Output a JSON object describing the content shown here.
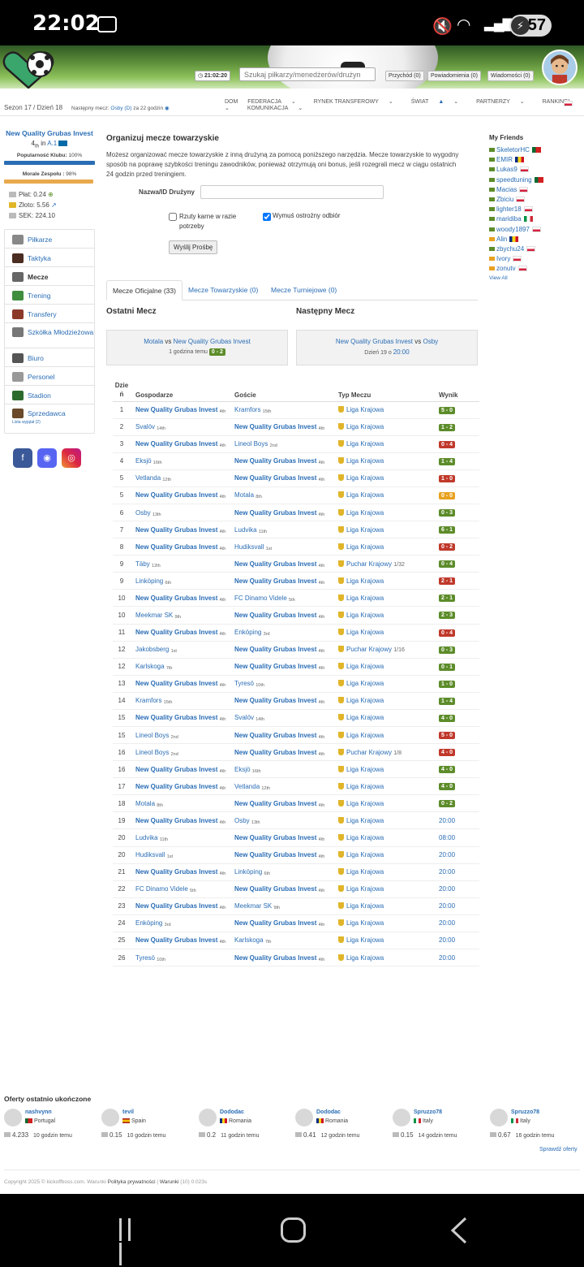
{
  "status": {
    "time": "22:02",
    "battery": "57"
  },
  "header": {
    "clock": "21:02:20",
    "search_placeholder": "Szukaj piłkarzy/menedżerów/drużyn",
    "income": "Przychód (0)",
    "notifications": "Powiadomienia (0)",
    "messages": "Wiadomości (0)"
  },
  "subheader": {
    "season": "Sezon 17 / Dzień 18",
    "next_prefix": "Następny mecz: ",
    "next_team": "Osby (D)",
    "next_suffix": " za 22 godzin",
    "nav": [
      "DOM",
      "FEDERACJA",
      "RYNEK TRANSFEROWY",
      "ŚWIAT",
      "PARTNERZY",
      "RANKINGI",
      "KOMUNIKACJA"
    ]
  },
  "club": {
    "name": "New Quality Grubas Invest",
    "rank_pos": "4",
    "rank_suffix": "th",
    "rank_in": " in ",
    "league": "A.1",
    "popularity_label": "Popularność Klubu:",
    "popularity": "100%",
    "popularity_value": 100,
    "morale_label": "Morale Zespołu :",
    "morale": "98%",
    "morale_value": 98,
    "salary": "Płat: 0.24",
    "gold": "Złoto: 5.56",
    "sek": "SEK: 224.10"
  },
  "sidenav": [
    "Piłkarze",
    "Taktyka",
    "Mecze",
    "Trening",
    "Transfery",
    "Szkółka Młodzieżowa",
    "Biuro",
    "Personel",
    "Stadion",
    "Sprzedawca"
  ],
  "sidenav_sub": "Lista wyjątał (2)",
  "organize": {
    "title": "Organizuj mecze towarzyskie",
    "desc": "Możesz organizować mecze towarzyskie z inną drużyną za pomocą poniższego narzędzia. Mecze towarzyskie to wygodny sposób na poprawę szybkości treningu zawodników, ponieważ otrzymują oni bonus, jeśli rozegrali mecz w ciągu ostatnich 24 godzin przed treningiem.",
    "team_label": "Nazwa/ID Drużyny",
    "penalties_label": "Rzuty karne w razie potrzeby",
    "careful_label": "Wymuś ostrożny odbiór",
    "send_label": "Wyślij Prośbę"
  },
  "tabs": [
    "Mecze Oficjalne (33)",
    "Mecze Towarzyskie (0)",
    "Mecze Turniejowe (0)"
  ],
  "last_match": {
    "title": "Ostatni Mecz",
    "home": "Motala",
    "vs": " vs ",
    "away": "New Quality Grubas Invest",
    "when": "1 godzina temu",
    "score": "0 - 2"
  },
  "next_match": {
    "title": "Następny Mecz",
    "home": "New Quality Grubas Invest",
    "vs": " vs ",
    "away": "Osby",
    "when": "Dzień 19 o ",
    "time": "20:00"
  },
  "table": {
    "headers": [
      "Dzień",
      "Gospodarze",
      "Goście",
      "Typ Meczu",
      "Wynik"
    ],
    "rows": [
      {
        "day": "1",
        "home": "New Quality Grubas Invest",
        "hr": "4th",
        "away": "Kramfors",
        "ar": "15th",
        "type": "Liga Krajowa",
        "result": "5 - 0",
        "res": "w"
      },
      {
        "day": "2",
        "home": "Svalöv",
        "hr": "14th",
        "away": "New Quality Grubas Invest",
        "ar": "4th",
        "type": "Liga Krajowa",
        "result": "1 - 2",
        "res": "w"
      },
      {
        "day": "3",
        "home": "New Quality Grubas Invest",
        "hr": "4th",
        "away": "Lineol Boys",
        "ar": "2nd",
        "type": "Liga Krajowa",
        "result": "0 - 4",
        "res": "l"
      },
      {
        "day": "4",
        "home": "Eksjö",
        "hr": "16th",
        "away": "New Quality Grubas Invest",
        "ar": "4th",
        "type": "Liga Krajowa",
        "result": "1 - 4",
        "res": "w"
      },
      {
        "day": "5",
        "home": "Vetlanda",
        "hr": "12th",
        "away": "New Quality Grubas Invest",
        "ar": "4th",
        "type": "Liga Krajowa",
        "result": "1 - 0",
        "res": "l"
      },
      {
        "day": "5",
        "home": "New Quality Grubas Invest",
        "hr": "4th",
        "away": "Motala",
        "ar": "8th",
        "type": "Liga Krajowa",
        "result": "0 - 0",
        "res": "d"
      },
      {
        "day": "6",
        "home": "Osby",
        "hr": "13th",
        "away": "New Quality Grubas Invest",
        "ar": "4th",
        "type": "Liga Krajowa",
        "result": "0 - 3",
        "res": "w"
      },
      {
        "day": "7",
        "home": "New Quality Grubas Invest",
        "hr": "4th",
        "away": "Ludvika",
        "ar": "11th",
        "type": "Liga Krajowa",
        "result": "6 - 1",
        "res": "w"
      },
      {
        "day": "8",
        "home": "New Quality Grubas Invest",
        "hr": "4th",
        "away": "Hudiksvall",
        "ar": "1st",
        "type": "Liga Krajowa",
        "result": "0 - 2",
        "res": "l"
      },
      {
        "day": "9",
        "home": "Täby",
        "hr": "12th",
        "away": "New Quality Grubas Invest",
        "ar": "4th",
        "type": "Puchar Krajowy",
        "round": "1/32",
        "result": "0 - 4",
        "res": "w"
      },
      {
        "day": "9",
        "home": "Linköping",
        "hr": "6th",
        "away": "New Quality Grubas Invest",
        "ar": "4th",
        "type": "Liga Krajowa",
        "result": "2 - 1",
        "res": "l"
      },
      {
        "day": "10",
        "home": "New Quality Grubas Invest",
        "hr": "4th",
        "away": "FC Dinamo Videle",
        "ar": "5th",
        "type": "Liga Krajowa",
        "result": "2 - 1",
        "res": "w"
      },
      {
        "day": "10",
        "home": "Meekmar SK",
        "hr": "9th",
        "away": "New Quality Grubas Invest",
        "ar": "4th",
        "type": "Liga Krajowa",
        "result": "2 - 3",
        "res": "w"
      },
      {
        "day": "11",
        "home": "New Quality Grubas Invest",
        "hr": "4th",
        "away": "Enköping",
        "ar": "3rd",
        "type": "Liga Krajowa",
        "result": "0 - 4",
        "res": "l"
      },
      {
        "day": "12",
        "home": "Jakobsberg",
        "hr": "1st",
        "away": "New Quality Grubas Invest",
        "ar": "4th",
        "type": "Puchar Krajowy",
        "round": "1/16",
        "result": "0 - 3",
        "res": "w"
      },
      {
        "day": "12",
        "home": "Karlskoga",
        "hr": "7th",
        "away": "New Quality Grubas Invest",
        "ar": "4th",
        "type": "Liga Krajowa",
        "result": "0 - 1",
        "res": "w"
      },
      {
        "day": "13",
        "home": "New Quality Grubas Invest",
        "hr": "4th",
        "away": "Tyresö",
        "ar": "10th",
        "type": "Liga Krajowa",
        "result": "1 - 0",
        "res": "w"
      },
      {
        "day": "14",
        "home": "Kramfors",
        "hr": "15th",
        "away": "New Quality Grubas Invest",
        "ar": "4th",
        "type": "Liga Krajowa",
        "result": "1 - 4",
        "res": "w"
      },
      {
        "day": "15",
        "home": "New Quality Grubas Invest",
        "hr": "4th",
        "away": "Svalöv",
        "ar": "14th",
        "type": "Liga Krajowa",
        "result": "4 - 0",
        "res": "w"
      },
      {
        "day": "15",
        "home": "Lineol Boys",
        "hr": "2nd",
        "away": "New Quality Grubas Invest",
        "ar": "4th",
        "type": "Liga Krajowa",
        "result": "5 - 0",
        "res": "l"
      },
      {
        "day": "16",
        "home": "Lineol Boys",
        "hr": "2nd",
        "away": "New Quality Grubas Invest",
        "ar": "4th",
        "type": "Puchar Krajowy",
        "round": "1/8",
        "result": "4 - 0",
        "res": "l"
      },
      {
        "day": "16",
        "home": "New Quality Grubas Invest",
        "hr": "4th",
        "away": "Eksjö",
        "ar": "16th",
        "type": "Liga Krajowa",
        "result": "4 - 0",
        "res": "w"
      },
      {
        "day": "17",
        "home": "New Quality Grubas Invest",
        "hr": "4th",
        "away": "Vetlanda",
        "ar": "12th",
        "type": "Liga Krajowa",
        "result": "4 - 0",
        "res": "w"
      },
      {
        "day": "18",
        "home": "Motala",
        "hr": "8th",
        "away": "New Quality Grubas Invest",
        "ar": "4th",
        "type": "Liga Krajowa",
        "result": "0 - 2",
        "res": "w"
      },
      {
        "day": "19",
        "home": "New Quality Grubas Invest",
        "hr": "4th",
        "away": "Osby",
        "ar": "13th",
        "type": "Liga Krajowa",
        "result": "20:00",
        "res": "t"
      },
      {
        "day": "20",
        "home": "Ludvika",
        "hr": "11th",
        "away": "New Quality Grubas Invest",
        "ar": "4th",
        "type": "Liga Krajowa",
        "result": "08:00",
        "res": "t"
      },
      {
        "day": "20",
        "home": "Hudiksvall",
        "hr": "1st",
        "away": "New Quality Grubas Invest",
        "ar": "4th",
        "type": "Liga Krajowa",
        "result": "20:00",
        "res": "t"
      },
      {
        "day": "21",
        "home": "New Quality Grubas Invest",
        "hr": "4th",
        "away": "Linköping",
        "ar": "6th",
        "type": "Liga Krajowa",
        "result": "20:00",
        "res": "t"
      },
      {
        "day": "22",
        "home": "FC Dinamo Videle",
        "hr": "5th",
        "away": "New Quality Grubas Invest",
        "ar": "4th",
        "type": "Liga Krajowa",
        "result": "20:00",
        "res": "t"
      },
      {
        "day": "23",
        "home": "New Quality Grubas Invest",
        "hr": "4th",
        "away": "Meekmar SK",
        "ar": "9th",
        "type": "Liga Krajowa",
        "result": "20:00",
        "res": "t"
      },
      {
        "day": "24",
        "home": "Enköping",
        "hr": "3rd",
        "away": "New Quality Grubas Invest",
        "ar": "4th",
        "type": "Liga Krajowa",
        "result": "20:00",
        "res": "t"
      },
      {
        "day": "25",
        "home": "New Quality Grubas Invest",
        "hr": "4th",
        "away": "Karlskoga",
        "ar": "7th",
        "type": "Liga Krajowa",
        "result": "20:00",
        "res": "t"
      },
      {
        "day": "26",
        "home": "Tyresö",
        "hr": "10th",
        "away": "New Quality Grubas Invest",
        "ar": "4th",
        "type": "Liga Krajowa",
        "result": "20:00",
        "res": "t"
      }
    ]
  },
  "friends": {
    "title": "My Friends",
    "list": [
      {
        "name": "SkeletorHC",
        "flag": "pt",
        "env": "g"
      },
      {
        "name": "EMIR",
        "flag": "ro",
        "env": "g"
      },
      {
        "name": "Lukas9",
        "flag": "pl",
        "env": "g"
      },
      {
        "name": "speedtuning",
        "flag": "pt",
        "env": "g"
      },
      {
        "name": "Macias",
        "flag": "pl",
        "env": "g"
      },
      {
        "name": "Zbiciu",
        "flag": "pl",
        "env": "g"
      },
      {
        "name": "lighter18",
        "flag": "pl",
        "env": "g"
      },
      {
        "name": "maridiba",
        "flag": "it",
        "env": "g"
      },
      {
        "name": "woody1897",
        "flag": "pl",
        "env": "g"
      },
      {
        "name": "Alin",
        "flag": "ro",
        "env": "o"
      },
      {
        "name": "zbychu24",
        "flag": "pl",
        "env": "g"
      },
      {
        "name": "Ivory",
        "flag": "pl",
        "env": "o"
      },
      {
        "name": "zonutv",
        "flag": "pl",
        "env": "o"
      }
    ],
    "view_all": "View All"
  },
  "offers": {
    "title": "Oferty ostatnio ukończone",
    "list": [
      {
        "name": "nashvynn",
        "country": "Portugal",
        "flag": "pt",
        "price": "4.233",
        "time": "10 godzin temu"
      },
      {
        "name": "tevil",
        "country": "Spain",
        "flag": "es",
        "price": "0.15",
        "time": "10 godzin temu"
      },
      {
        "name": "Dododac",
        "country": "Romania",
        "flag": "ro",
        "price": "0.2",
        "time": "11 godzin temu"
      },
      {
        "name": "Dododac",
        "country": "Romania",
        "flag": "ro",
        "price": "0.41",
        "time": "12 godzin temu"
      },
      {
        "name": "Spruzzo78",
        "country": "Italy",
        "flag": "it",
        "price": "0.15",
        "time": "14 godzin temu"
      },
      {
        "name": "Spruzzo78",
        "country": "Italy",
        "flag": "it",
        "price": "0.67",
        "time": "16 godzin temu"
      }
    ],
    "check": "Sprawdź oferty"
  },
  "footer": {
    "copy": "Copyright 2025 © kickoffboss.com. Warunki ",
    "privacy": "Polityka prywatności",
    "sep": " | ",
    "terms": "Warunki",
    "extra": " (10) 0.023s"
  },
  "colors": {
    "link": "#2a6db5",
    "win": "#5d8c2a",
    "loss": "#c0392b",
    "draw": "#e8a21f"
  }
}
